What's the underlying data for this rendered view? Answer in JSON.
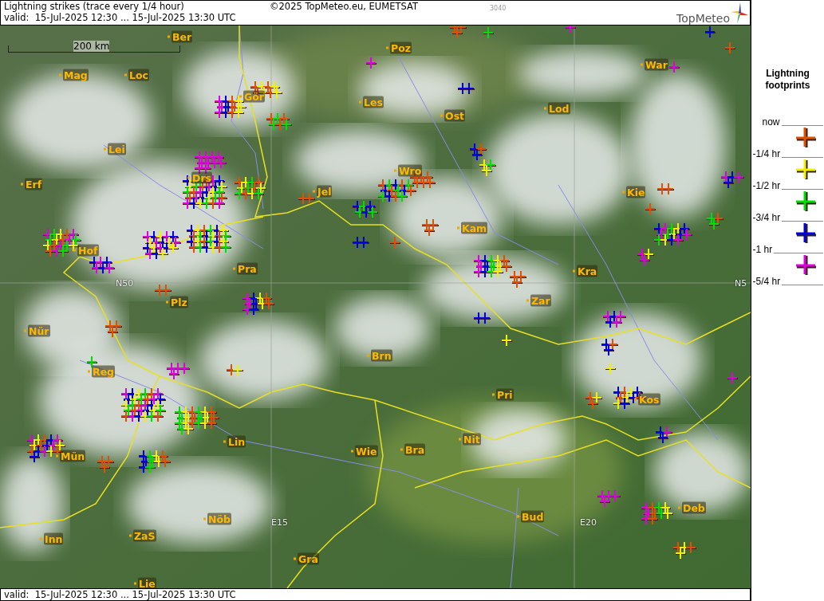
{
  "header": {
    "title": "Lightning strikes (trace every 1/4 hour)",
    "copyright": "©2025 TopMeteo.eu, EUMETSAT",
    "code": "3040",
    "valid": "valid:  15-Jul-2025 12:30 ... 15-Jul-2025 13:30 UTC",
    "logo": "TopMeteo"
  },
  "map": {
    "scale": "200 km",
    "cities": [
      "Ber",
      "Mag",
      "Loc",
      "Lei",
      "Erf",
      "Hof",
      "Nür",
      "Reg",
      "Mün",
      "Inn",
      "ZaS",
      "Lie",
      "Nöb",
      "Gra",
      "Lin",
      "Wie",
      "Bra",
      "Brn",
      "Plz",
      "Pra",
      "Drs",
      "Gör",
      "Jel",
      "Poz",
      "Les",
      "Ost",
      "Lod",
      "Wro",
      "Kam",
      "Kra",
      "Zar",
      "Pri",
      "Nit",
      "Bud",
      "Kos",
      "Deb",
      "Kie",
      "War"
    ],
    "grid_labels": [
      "N50",
      "E15",
      "E20",
      "N5"
    ]
  },
  "footer": {
    "valid": "valid:  15-Jul-2025 12:30 ... 15-Jul-2025 13:30 UTC"
  },
  "legend": {
    "title": "Lightning footprints",
    "ticks": [
      "now",
      "-1/4 hr",
      "-1/2 hr",
      "-3/4 hr",
      "-1 hr",
      "-5/4 hr"
    ],
    "items": [
      {
        "color": "#e05000"
      },
      {
        "color": "#f0f000"
      },
      {
        "color": "#00e000"
      },
      {
        "color": "#0000e0"
      },
      {
        "color": "#e000e0"
      }
    ]
  }
}
